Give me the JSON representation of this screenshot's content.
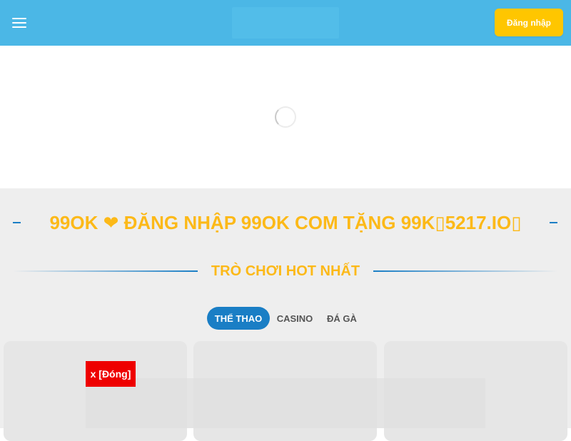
{
  "header": {
    "login_label": "Đăng nhập"
  },
  "content": {
    "main_title": "99OK ❤ ĐĂNG NHẬP 99OK COM TẶNG 99K▯5217.IO▯",
    "section_title": "TRÒ CHƠI HOT NHẤT",
    "tabs": [
      {
        "label": "THỂ THAO",
        "active": true
      },
      {
        "label": "CASINO",
        "active": false
      },
      {
        "label": "ĐÁ GÀ",
        "active": false
      }
    ]
  },
  "ad": {
    "close_label": "x [Đóng]"
  },
  "colors": {
    "header": "#4bb7e6",
    "login": "#ffc600",
    "accent_gold": "#fcb918",
    "accent_blue": "#1a7ec5",
    "close_red": "#ee0000"
  }
}
